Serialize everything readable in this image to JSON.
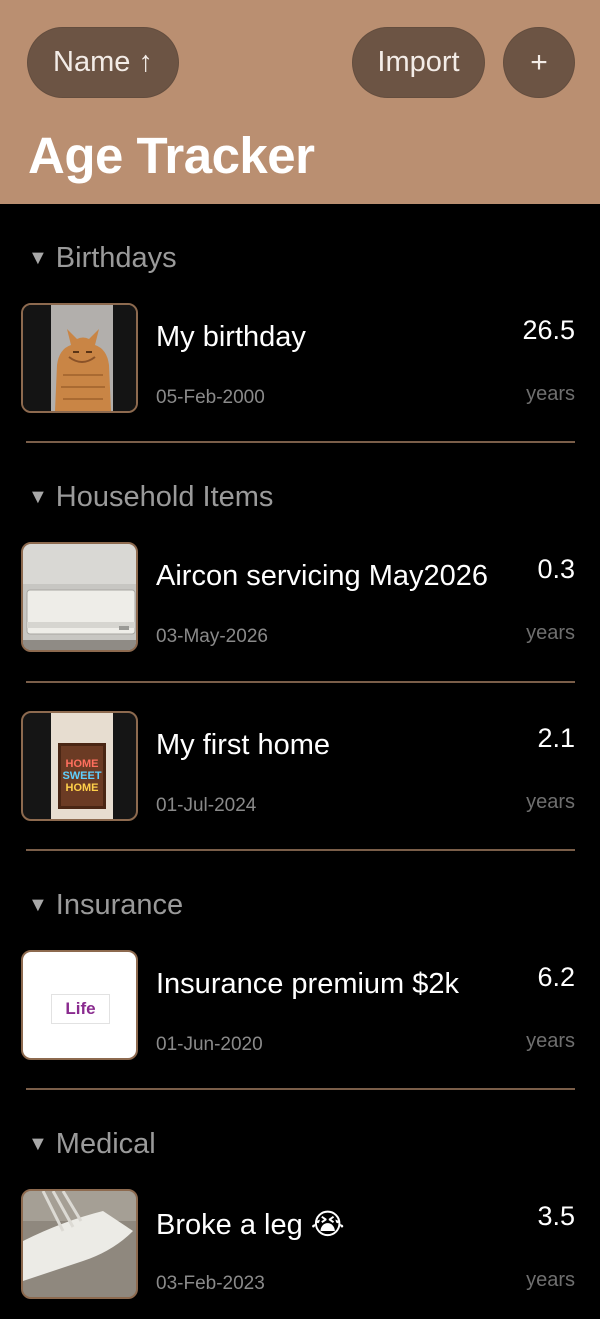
{
  "toolbar": {
    "sort_label": "Name ↑",
    "import_label": "Import",
    "add_label": "+"
  },
  "title": "Age Tracker",
  "colors": {
    "header_bg": "#ba8f71",
    "button_bg": "#6c5444",
    "divider": "#7a5e49",
    "background": "#000000"
  },
  "sections": [
    {
      "title": "Birthdays",
      "toggle_icon": "triangle-down",
      "items": [
        {
          "name": "My birthday",
          "date": "05-Feb-2000",
          "age": "26.5",
          "unit": "years",
          "thumbnail": "cat-photo"
        }
      ]
    },
    {
      "title": "Household Items",
      "toggle_icon": "triangle-down",
      "items": [
        {
          "name": "Aircon servicing May2026",
          "date": "03-May-2026",
          "age": "0.3",
          "unit": "years",
          "thumbnail": "aircon-photo"
        },
        {
          "name": "My first home",
          "date": "01-Jul-2024",
          "age": "2.1",
          "unit": "years",
          "thumbnail": "home-sweet-home-sign",
          "thumbnail_text": [
            "HOME",
            "SWEET",
            "HOME"
          ]
        }
      ]
    },
    {
      "title": "Insurance",
      "toggle_icon": "triangle-down",
      "items": [
        {
          "name": "Insurance premium $2k",
          "date": "01-Jun-2020",
          "age": "6.2",
          "unit": "years",
          "thumbnail": "life-logo",
          "thumbnail_text": "Life"
        }
      ]
    },
    {
      "title": "Medical",
      "toggle_icon": "triangle-down",
      "items": [
        {
          "name": "Broke a leg 😭",
          "date": "03-Feb-2023",
          "age": "3.5",
          "unit": "years",
          "thumbnail": "leg-cast-photo"
        }
      ]
    }
  ]
}
